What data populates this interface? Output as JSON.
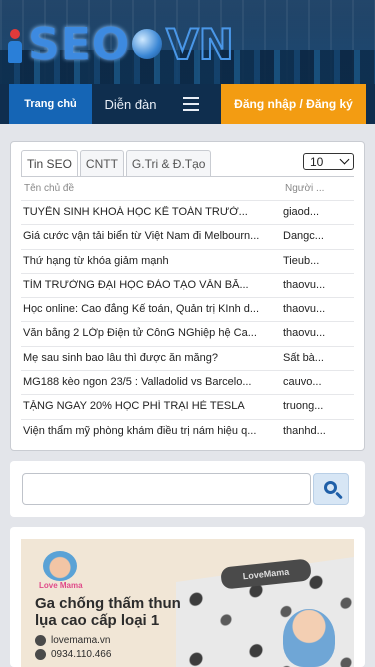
{
  "header": {
    "logo_text": "SEO",
    "logo_suffix": "VN"
  },
  "nav": {
    "home_label": "Trang chủ",
    "forum_label": "Diễn đàn",
    "login_label": "Đăng nhập / Đăng ký"
  },
  "topics": {
    "tabs": [
      {
        "label": "Tin SEO"
      },
      {
        "label": "CNTT"
      },
      {
        "label": "G.Tri & Đ.Tạo"
      }
    ],
    "page_size": "10",
    "columns": {
      "title": "Tên chủ đề",
      "author": "Người ..."
    },
    "rows": [
      {
        "title": "TUYỂN SINH KHOÁ HỌC KẾ TOÁN TRƯỞ...",
        "author": "giaod..."
      },
      {
        "title": "Giá cước vận tải biển từ Việt Nam đi Melbourn...",
        "author": "Dangc..."
      },
      {
        "title": "Thứ hạng từ khóa giảm mạnh",
        "author": "Tieub..."
      },
      {
        "title": "TÌM TRƯỜNG ĐẠI HỌC ĐÀO TẠO VĂN BẰ...",
        "author": "thaovu..."
      },
      {
        "title": "Học online: Cao đẳng Kế toán, Quản trị KInh d...",
        "author": "thaovu..."
      },
      {
        "title": "Văn bằng 2 LỚp Điện tử CônG NGhiệp hệ Ca...",
        "author": "thaovu..."
      },
      {
        "title": "Mẹ sau sinh bao lâu thì được ăn măng?",
        "author": "Sất bà..."
      },
      {
        "title": "MG188 kèo ngon 23/5 : Valladolid vs Barcelo...",
        "author": "cauvo..."
      },
      {
        "title": "TẶNG NGAY 20% HỌC PHÍ TRẠI HÈ TESLA",
        "author": "truong..."
      },
      {
        "title": "Viện thẩm mỹ phòng khám điều trị nám hiệu q...",
        "author": "thanhd..."
      }
    ]
  },
  "search": {
    "value": "",
    "placeholder": ""
  },
  "ad": {
    "brand": "Love Mama",
    "pillow_text": "LoveMama",
    "headline_line1": "Ga chống thấm thun",
    "headline_line2": "lụa cao cấp loại 1",
    "website": "lovemama.vn",
    "phone": "0934.110.466"
  },
  "colors": {
    "nav_bg": "#0f2e4e",
    "home_tab": "#1565b5",
    "login_button": "#f39c12",
    "page_bg": "#e3e5ea"
  }
}
